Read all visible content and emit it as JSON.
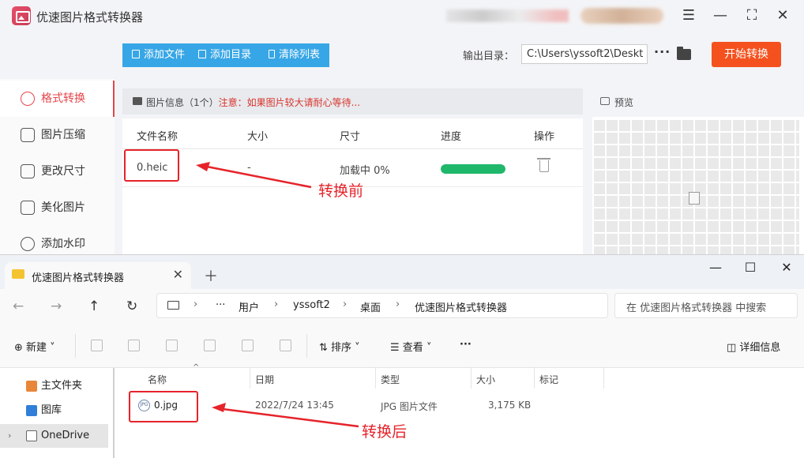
{
  "app": {
    "title": "优速图片格式转换器",
    "toolbar": {
      "add_file": "添加文件",
      "add_dir": "添加目录",
      "clear_list": "清除列表"
    },
    "output_label": "输出目录：",
    "output_path": "C:\\Users\\yssoft2\\Deskt",
    "more": "···",
    "start_button": "开始转换",
    "sidebar": [
      "格式转换",
      "图片压缩",
      "更改尺寸",
      "美化图片",
      "添加水印"
    ],
    "info_label": "图片信息（1个）",
    "info_note": "注意：如果图片较大请耐心等待...",
    "columns": [
      "文件名称",
      "大小",
      "尺寸",
      "进度",
      "操作"
    ],
    "row": {
      "name": "0.heic",
      "size": "-",
      "dims": "加载中 0%",
      "progress": 1.0
    },
    "preview_label": "预览"
  },
  "annotations": {
    "before": "转换前",
    "after": "转换后"
  },
  "explorer": {
    "tab_title": "优速图片格式转换器",
    "breadcrumbs": [
      "用户",
      "yssoft2",
      "桌面",
      "优速图片格式转换器"
    ],
    "search_placeholder": "在 优速图片格式转换器 中搜索",
    "commands": {
      "new": "新建",
      "sort": "排序",
      "view": "查看",
      "details": "详细信息"
    },
    "nav": [
      "主文件夹",
      "图库",
      "OneDrive"
    ],
    "columns": [
      "名称",
      "日期",
      "类型",
      "大小",
      "标记"
    ],
    "file": {
      "name": "0.jpg",
      "date": "2022/7/24 13:45",
      "type": "JPG 图片文件",
      "size": "3,175 KB"
    }
  },
  "colors": {
    "accent": "#37a6e6",
    "start": "#f4511e",
    "active": "#e5454a",
    "annotation": "#e6232a",
    "progress": "#1fb86b"
  }
}
